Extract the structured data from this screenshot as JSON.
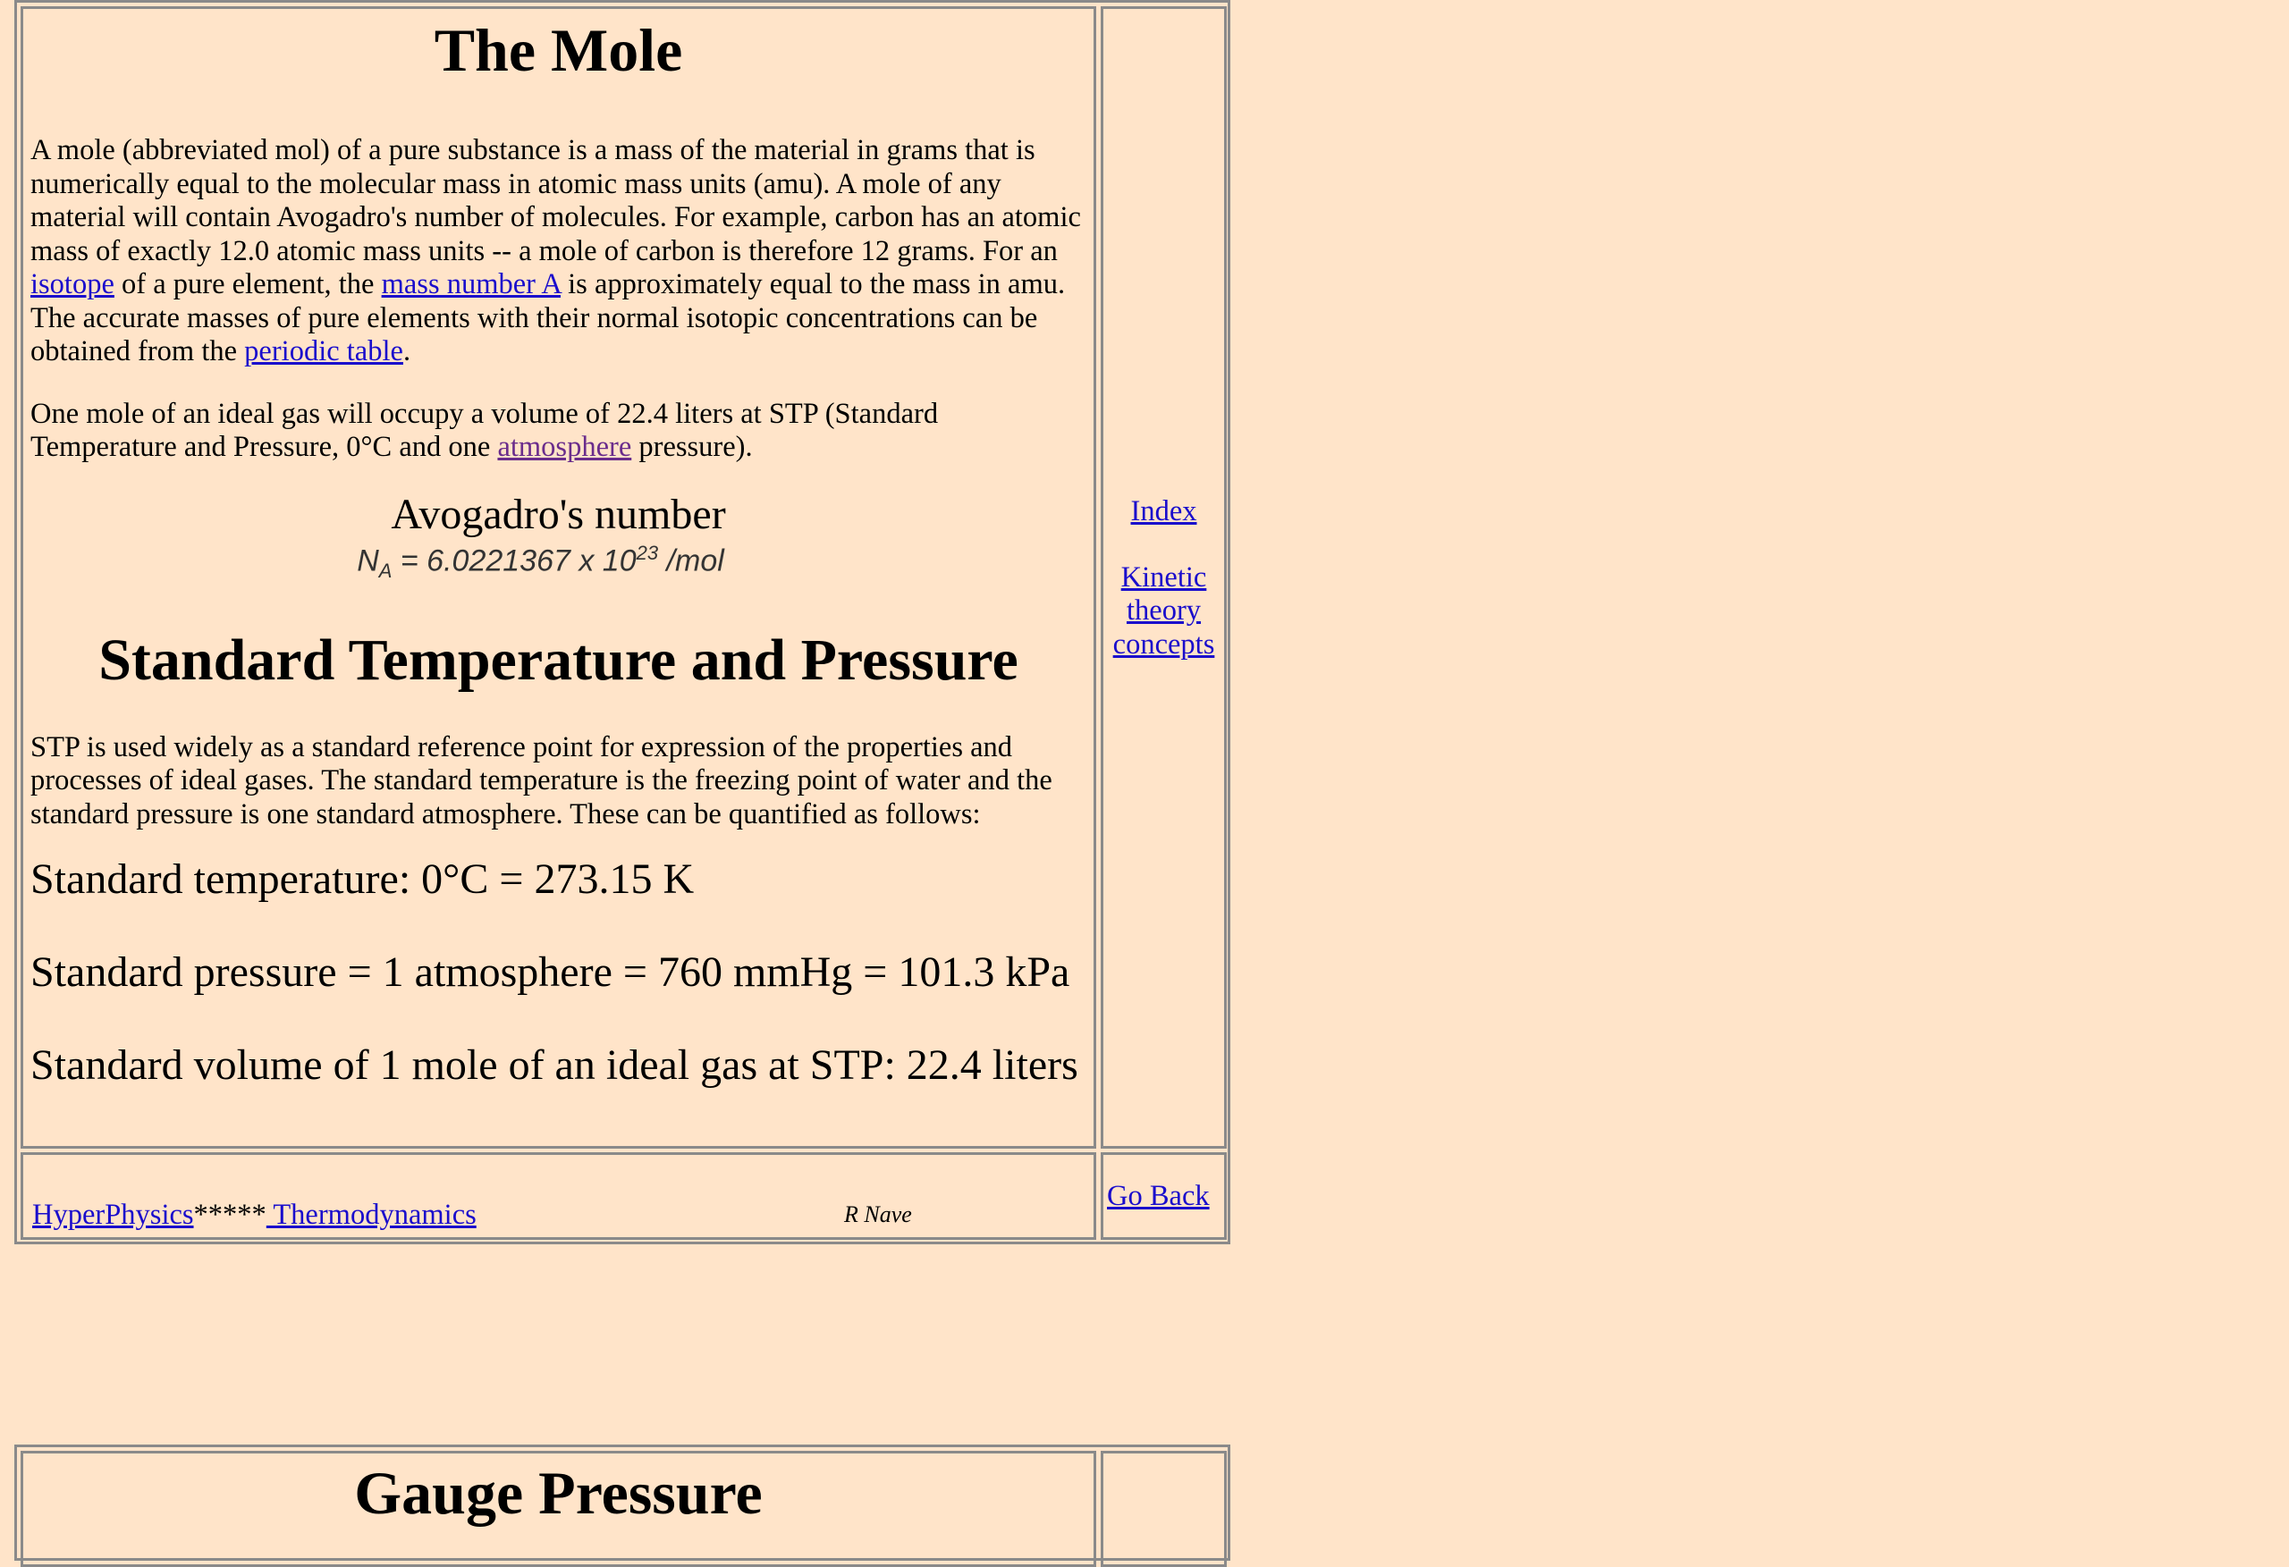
{
  "mole": {
    "title": "The Mole",
    "para1": {
      "t1": "A mole (abbreviated mol) of a pure substance is a mass of the material in grams that is numerically equal to the molecular mass in atomic mass units (amu). A mole of any material will contain Avogadro's number of molecules. For example, carbon has an atomic mass of exactly 12.0 atomic mass units -- a mole of carbon is therefore 12 grams. For an ",
      "link_isotope": "isotope",
      "t2": " of a pure element, the ",
      "link_mass_number": "mass number A",
      "t3": " is approximately equal to the mass in amu. The accurate masses of pure elements with their normal isotopic concentrations can be obtained from the ",
      "link_periodic": "periodic table",
      "t4": "."
    },
    "para2": {
      "t1": "One mole of an ideal gas will occupy a volume of 22.4 liters at STP (Standard Temperature and Pressure, 0°C and one ",
      "link_atmosphere": "atmosphere",
      "t2": " pressure)."
    },
    "avogadro_heading": "Avogadro's number",
    "formula": {
      "symbol": "N",
      "sub": "A",
      "value": " = 6.0221367 x 10",
      "exp": "23",
      "unit": " /mol"
    }
  },
  "stp": {
    "title": "Standard Temperature and Pressure",
    "para": "STP is used widely as a standard reference point for expression of the properties and processes of ideal gases. The standard temperature is the freezing point of water and the standard pressure is one standard atmosphere. These can be quantified as follows:",
    "line1": "Standard temperature: 0°C = 273.15 K",
    "line2": "Standard pressure = 1 atmosphere = 760 mmHg = 101.3 kPa",
    "line3": "Standard volume of 1 mole of an ideal gas at STP: 22.4 liters"
  },
  "side": {
    "index": "Index",
    "kinetic_line1": "Kinetic",
    "kinetic_line2": "theory",
    "kinetic_line3": "concepts"
  },
  "footer": {
    "hyperphysics": "HyperPhysics",
    "stars": "*****",
    "thermo": " Thermodynamics",
    "author": "R Nave",
    "go_back": "Go Back"
  },
  "gauge": {
    "title": "Gauge Pressure"
  }
}
